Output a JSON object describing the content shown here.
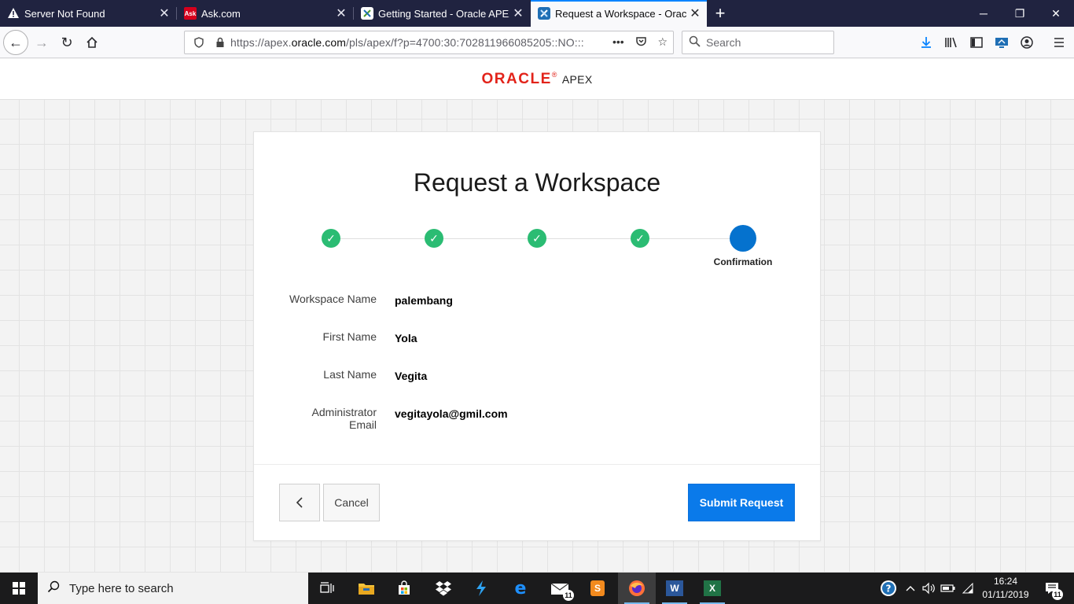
{
  "browser": {
    "tabs": [
      {
        "title": "Server Not Found",
        "favicon": "warning-icon"
      },
      {
        "title": "Ask.com",
        "favicon": "ask-logo-icon"
      },
      {
        "title": "Getting Started - Oracle APEX",
        "favicon": "apex-icon"
      },
      {
        "title": "Request a Workspace - Oracle APEX",
        "favicon": "apex-icon",
        "active": true
      }
    ],
    "url_prefix": "https://apex.",
    "url_domain": "oracle.com",
    "url_rest": "/pls/apex/f?p=4700:30:702811966085205::NO:::",
    "search_placeholder": "Search"
  },
  "header": {
    "brand": "ORACLE",
    "registered": "®",
    "product": "APEX"
  },
  "form": {
    "title": "Request a Workspace",
    "steps_completed": 4,
    "current_step_label": "Confirmation",
    "fields": [
      {
        "label": "Workspace Name",
        "value": "palembang"
      },
      {
        "label": "First Name",
        "value": "Yola"
      },
      {
        "label": "Last Name",
        "value": "Vegita"
      },
      {
        "label": "Administrator Email",
        "value": "vegitayola@gmil.com"
      }
    ],
    "prev_icon": "chevron-left-icon",
    "cancel_label": "Cancel",
    "submit_label": "Submit Request"
  },
  "taskbar": {
    "search_placeholder": "Type here to search",
    "mail_badge": "11",
    "notification_badge": "11",
    "time": "16:24",
    "date": "01/11/2019"
  },
  "colors": {
    "accent": "#0a7aea",
    "step_done": "#2bbc73",
    "step_current": "#0572ce",
    "oracle_red": "#e2231a"
  }
}
